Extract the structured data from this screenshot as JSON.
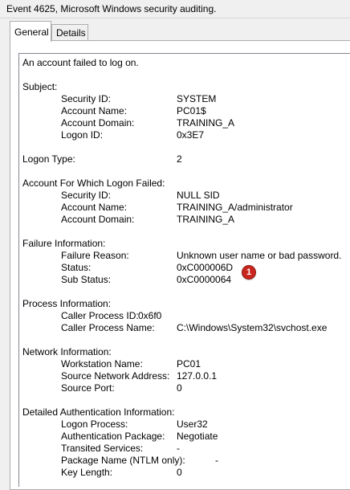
{
  "window": {
    "title": "Event 4625, Microsoft Windows security auditing."
  },
  "tabs": [
    {
      "label": "General"
    },
    {
      "label": "Details"
    }
  ],
  "event": {
    "headline": "An account failed to log on.",
    "subject": {
      "heading": "Subject:",
      "rows": [
        {
          "label": "Security ID:",
          "value": "SYSTEM"
        },
        {
          "label": "Account Name:",
          "value": "PC01$"
        },
        {
          "label": "Account Domain:",
          "value": "TRAINING_A"
        },
        {
          "label": "Logon ID:",
          "value": "0x3E7"
        }
      ]
    },
    "logon_type": {
      "label": "Logon Type:",
      "value": "2"
    },
    "failed_account": {
      "heading": "Account For Which Logon Failed:",
      "rows": [
        {
          "label": "Security ID:",
          "value": "NULL SID"
        },
        {
          "label": "Account Name:",
          "value": "TRAINING_A/administrator"
        },
        {
          "label": "Account Domain:",
          "value": "TRAINING_A"
        }
      ]
    },
    "failure": {
      "heading": "Failure Information:",
      "rows": [
        {
          "label": "Failure Reason:",
          "value": "Unknown user name or bad password."
        },
        {
          "label": "Status:",
          "value": "0xC000006D"
        },
        {
          "label": "Sub Status:",
          "value": "0xC0000064"
        }
      ]
    },
    "process": {
      "heading": "Process Information:",
      "rows": [
        {
          "label": "Caller Process ID:",
          "value": "0x6f0"
        },
        {
          "label": "Caller Process Name:",
          "value": "C:\\Windows\\System32\\svchost.exe"
        }
      ]
    },
    "network": {
      "heading": "Network Information:",
      "rows": [
        {
          "label": "Workstation Name:",
          "value": "PC01"
        },
        {
          "label": "Source Network Address:",
          "value": "127.0.0.1"
        },
        {
          "label": "Source Port:",
          "value": "0"
        }
      ]
    },
    "auth": {
      "heading": "Detailed Authentication Information:",
      "rows": [
        {
          "label": "Logon Process:",
          "value": "User32"
        },
        {
          "label": "Authentication Package:",
          "value": "Negotiate"
        },
        {
          "label": "Transited Services:",
          "value": "-"
        },
        {
          "label": "Package Name (NTLM only):",
          "value": "-"
        },
        {
          "label": "Key Length:",
          "value": "0"
        }
      ]
    }
  },
  "annotation": {
    "marker": "1",
    "color": "#c8261e"
  }
}
